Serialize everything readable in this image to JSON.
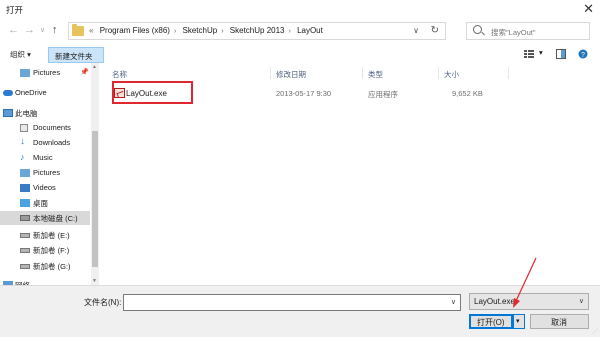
{
  "window": {
    "title": "打开",
    "close_glyph": "✕"
  },
  "nav": {
    "back_glyph": "←",
    "forward_glyph": "→",
    "up_glyph": "↑",
    "history_glyph": "∨",
    "breadcrumb_prefix": "«",
    "breadcrumb": [
      "Program Files (x86)",
      "SketchUp",
      "SketchUp 2013",
      "LayOut"
    ],
    "address_dropdown_glyph": "∨",
    "refresh_glyph": "↻",
    "search_placeholder": "搜索\"LayOut\""
  },
  "toolbar": {
    "organize": "组织 ▾",
    "new_folder": "新建文件夹",
    "view_dropdown": "▾"
  },
  "sidebar": {
    "items": [
      {
        "label": "Pictures",
        "icon": "pictures-icon",
        "pin": "📌"
      },
      {
        "label": "OneDrive",
        "icon": "onedrive-icon"
      },
      {
        "label": "此电脑",
        "icon": "computer-icon"
      },
      {
        "label": "Documents",
        "icon": "documents-icon"
      },
      {
        "label": "Downloads",
        "icon": "downloads-icon"
      },
      {
        "label": "Music",
        "icon": "music-icon"
      },
      {
        "label": "Pictures",
        "icon": "pictures-icon"
      },
      {
        "label": "Videos",
        "icon": "videos-icon"
      },
      {
        "label": "桌面",
        "icon": "desktop-icon"
      },
      {
        "label": "本地磁盘 (C:)",
        "icon": "drive-icon",
        "selected": true
      },
      {
        "label": "新加卷 (E:)",
        "icon": "drive-icon"
      },
      {
        "label": "新加卷 (F:)",
        "icon": "drive-icon"
      },
      {
        "label": "新加卷 (G:)",
        "icon": "drive-icon"
      },
      {
        "label": "网络",
        "icon": "network-icon"
      }
    ]
  },
  "columns": {
    "name": "名称",
    "date": "修改日期",
    "type": "类型",
    "size": "大小"
  },
  "files": [
    {
      "name": "LayOut.exe",
      "date": "2013-05-17 9:30",
      "type": "应用程序",
      "size": "9,652 KB"
    }
  ],
  "bottom": {
    "filename_label": "文件名(N):",
    "filename_value": "",
    "filetype_value": "LayOut.exe",
    "open_label": "打开(O)",
    "open_dropdown_glyph": "▾",
    "cancel_label": "取消"
  },
  "colors": {
    "highlight": "#e0262e",
    "selected_bg": "#d9d9d9",
    "accent": "#0078d7",
    "column_header": "#4d6082"
  }
}
